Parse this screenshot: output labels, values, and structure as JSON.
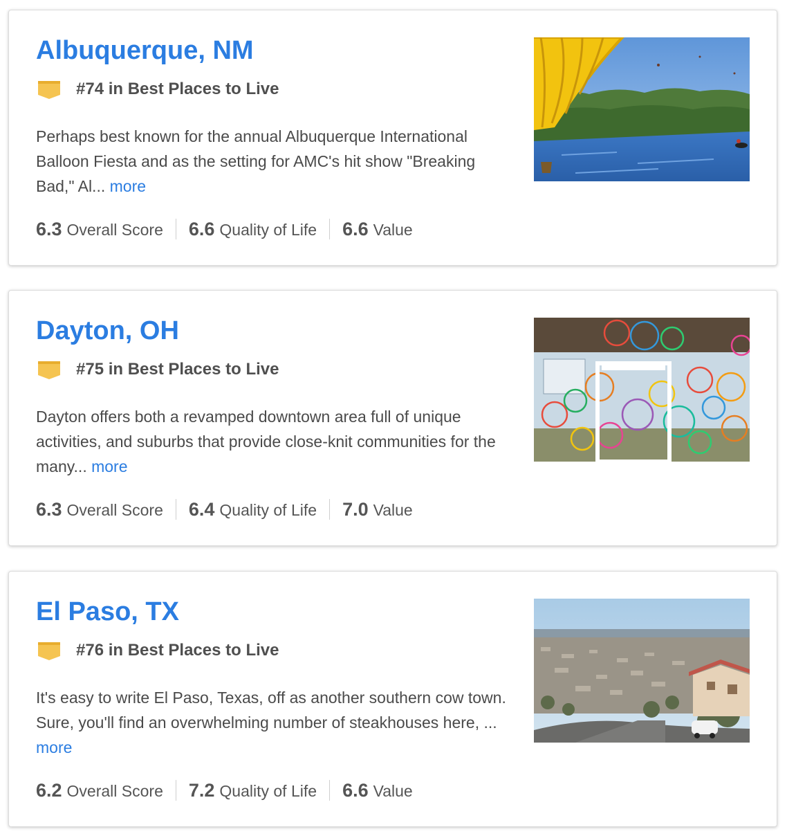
{
  "cities": [
    {
      "name": "Albuquerque, NM",
      "rank_text": "#74 in Best Places to Live",
      "description": "Perhaps best known for the annual Albuquerque International Balloon Fiesta and as the setting for AMC's hit show \"Breaking Bad,\" Al...",
      "more_label": "more",
      "scores": [
        {
          "value": "6.3",
          "label": "Overall Score"
        },
        {
          "value": "6.6",
          "label": "Quality of Life"
        },
        {
          "value": "6.6",
          "label": "Value"
        }
      ]
    },
    {
      "name": "Dayton, OH",
      "rank_text": "#75 in Best Places to Live",
      "description": "Dayton offers both a revamped downtown area full of unique activities, and suburbs that provide close-knit communities for the many...",
      "more_label": "more",
      "scores": [
        {
          "value": "6.3",
          "label": "Overall Score"
        },
        {
          "value": "6.4",
          "label": "Quality of Life"
        },
        {
          "value": "7.0",
          "label": "Value"
        }
      ]
    },
    {
      "name": "El Paso, TX",
      "rank_text": "#76 in Best Places to Live",
      "description": "It's easy to write El Paso, Texas, off as another southern cow town. Sure, you'll find an overwhelming number of steakhouses here, ...",
      "more_label": "more",
      "scores": [
        {
          "value": "6.2",
          "label": "Overall Score"
        },
        {
          "value": "7.2",
          "label": "Quality of Life"
        },
        {
          "value": "6.6",
          "label": "Value"
        }
      ]
    }
  ],
  "colors": {
    "link": "#2b7de1",
    "rank_badge": "#f5c451",
    "text": "#4a4a4a"
  },
  "icons": {
    "rank_badge": "rank-badge-icon"
  }
}
